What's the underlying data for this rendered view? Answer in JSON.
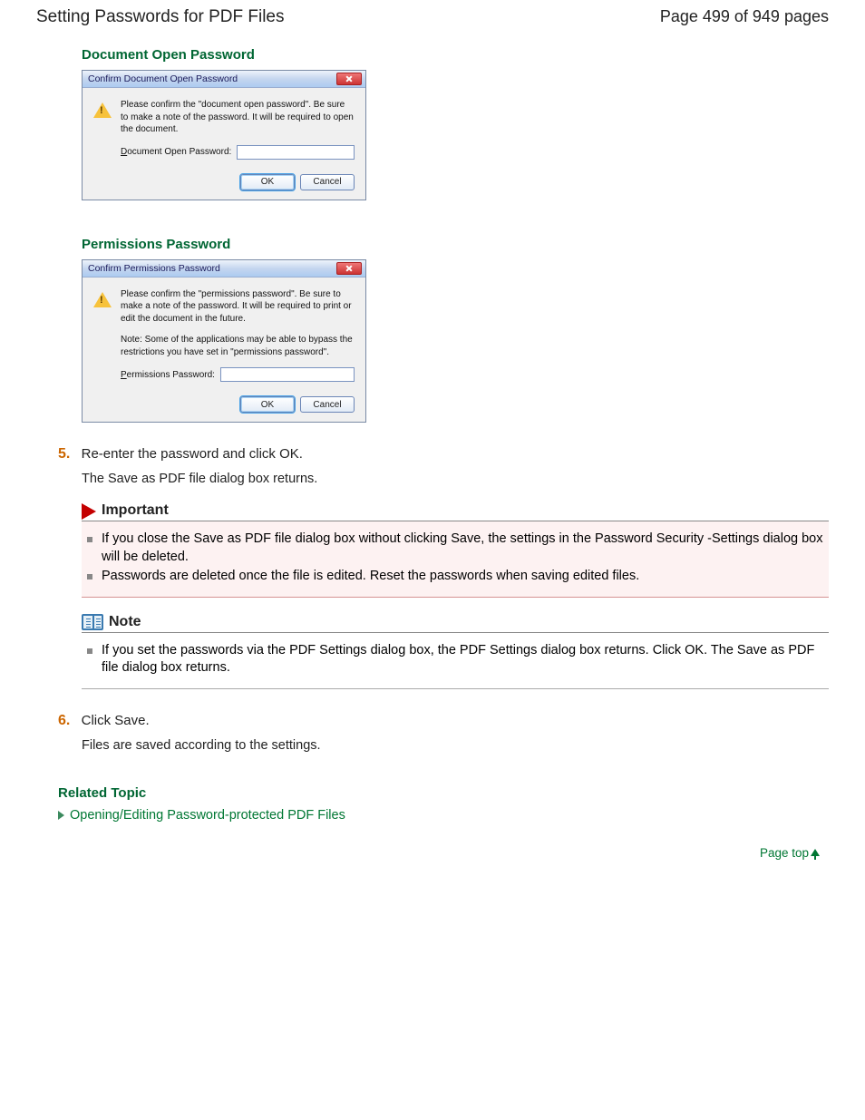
{
  "header": {
    "title": "Setting Passwords for PDF Files",
    "page_info": "Page 499 of 949 pages"
  },
  "section_doc_open": {
    "heading": "Document Open Password",
    "dialog": {
      "title": "Confirm Document Open Password",
      "message": "Please confirm the \"document open password\". Be sure to make a note of the password. It will be required to open the document.",
      "label_prefix": "D",
      "label_rest": "ocument Open Password:",
      "ok": "OK",
      "cancel": "Cancel"
    }
  },
  "section_perm": {
    "heading": "Permissions Password",
    "dialog": {
      "title": "Confirm Permissions Password",
      "message": "Please confirm the \"permissions password\". Be sure to make a note of the password. It will be required to print or edit the document in the future.",
      "note": "Note: Some of the applications may be able to bypass the restrictions you have set in \"permissions password\".",
      "label_prefix": "P",
      "label_rest": "ermissions Password:",
      "ok": "OK",
      "cancel": "Cancel"
    }
  },
  "step5": {
    "num": "5.",
    "text": "Re-enter the password and click OK.",
    "sub": "The Save as PDF file dialog box returns."
  },
  "important": {
    "title": "Important",
    "items": [
      "If you close the Save as PDF file dialog box without clicking Save, the settings in the Password Security -Settings dialog box will be deleted.",
      "Passwords are deleted once the file is edited. Reset the passwords when saving edited files."
    ]
  },
  "note": {
    "title": "Note",
    "items": [
      "If you set the passwords via the PDF Settings dialog box, the PDF Settings dialog box returns. Click OK. The Save as PDF file dialog box returns."
    ]
  },
  "step6": {
    "num": "6.",
    "text": "Click Save.",
    "sub": "Files are saved according to the settings."
  },
  "related": {
    "heading": "Related Topic",
    "link": "Opening/Editing Password-protected PDF Files"
  },
  "page_top": "Page top"
}
